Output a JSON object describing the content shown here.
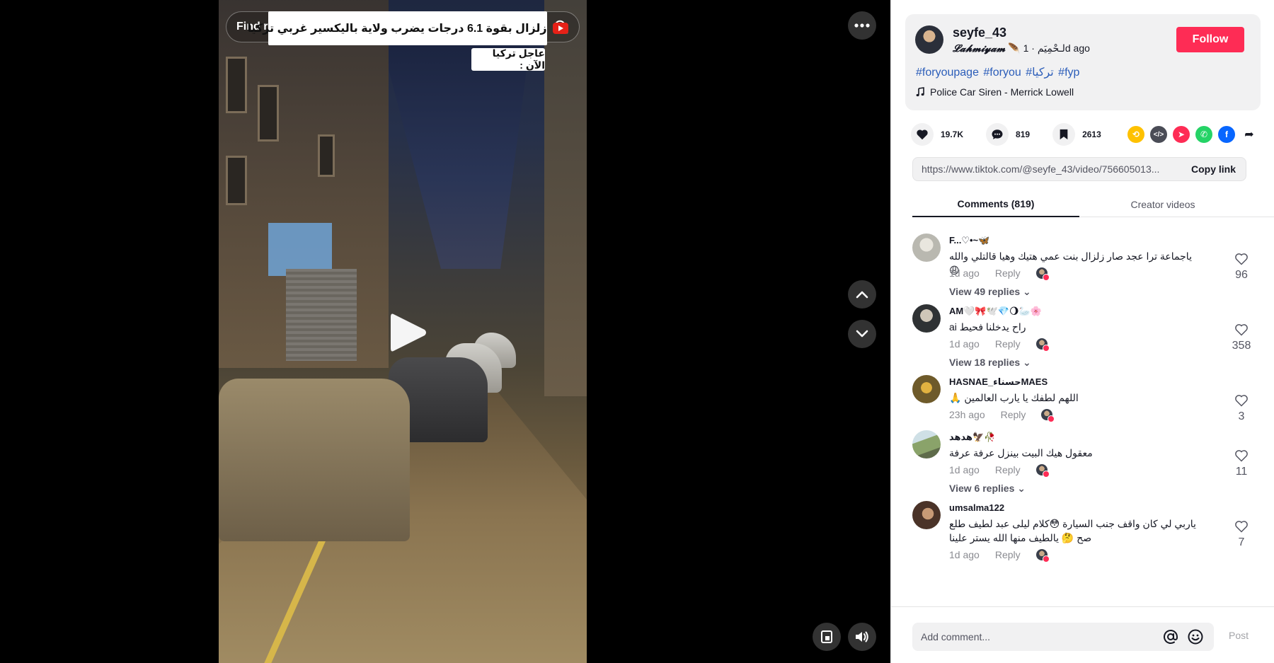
{
  "video": {
    "search_label": "Find related content",
    "headline": "زلزال بقوة 6.1 درجات يضرب ولاية باليكسير غربي تركيا",
    "urgent_tag": "عاجل تركيا الآن :"
  },
  "author": {
    "username": "seyfe_43",
    "nickname": "𝓛𝓪𝓱𝓶𝓲𝔂𝓪𝓶",
    "nickname_suffix": "🪶 لـحْمِيَم",
    "posted": "1d ago",
    "follow_label": "Follow",
    "hashtags": "#foryoupage #foryou #تركيا #fyp",
    "music": "Police Car Siren - Merrick Lowell"
  },
  "actions": {
    "likes": "19.7K",
    "comments": "819",
    "saves": "2613"
  },
  "share_colors": {
    "repost": "#fec100",
    "embed": "#4a4c56",
    "send": "#fe2c55",
    "whatsapp": "#25d366",
    "facebook": "#0866ff"
  },
  "link": {
    "url": "https://www.tiktok.com/@seyfe_43/video/756605013...",
    "copy_label": "Copy link"
  },
  "tabs": {
    "comments": "Comments (819)",
    "creator": "Creator videos"
  },
  "comments": [
    {
      "name": "F...♡•~🦋",
      "text": "ياجماعة ترا عجد صار زلزال بنت عمي هتيك وهيا قالتلي والله 😩",
      "time": "1d ago",
      "reply": "Reply",
      "likes": "96",
      "views": "View 49 replies",
      "avatar_color": "#b9b8b0"
    },
    {
      "name": "AM🤍🎀🕊️💎🌖🦢🌸",
      "text": "راح يدخلنا فحيط ai",
      "time": "1d ago",
      "reply": "Reply",
      "likes": "358",
      "views": "View 18 replies",
      "avatar_color": "#2f3234"
    },
    {
      "name": "HASNAE_حسناءMAES",
      "text": "اللهم لطفك يا يارب العالمين 🙏",
      "time": "23h ago",
      "reply": "Reply",
      "likes": "3",
      "views": "",
      "avatar_color": "#6e5a2a"
    },
    {
      "name": "هدهد🦅🥀",
      "text": "معقول هيك البيت بينزل عرفة عرفة",
      "time": "1d ago",
      "reply": "Reply",
      "likes": "11",
      "views": "View 6 replies",
      "avatar_color": "#7b8a6a"
    },
    {
      "name": "umsalma122",
      "text": "ياربي لي كان واقف جنب السيارة 😳كلام ليلى عبد لطيف طلع صح 🤔 يالطيف منها الله يستر علينا",
      "time": "1d ago",
      "reply": "Reply",
      "likes": "7",
      "views": "",
      "avatar_color": "#4a3328"
    }
  ],
  "comment_bar": {
    "placeholder": "Add comment...",
    "post_label": "Post"
  }
}
